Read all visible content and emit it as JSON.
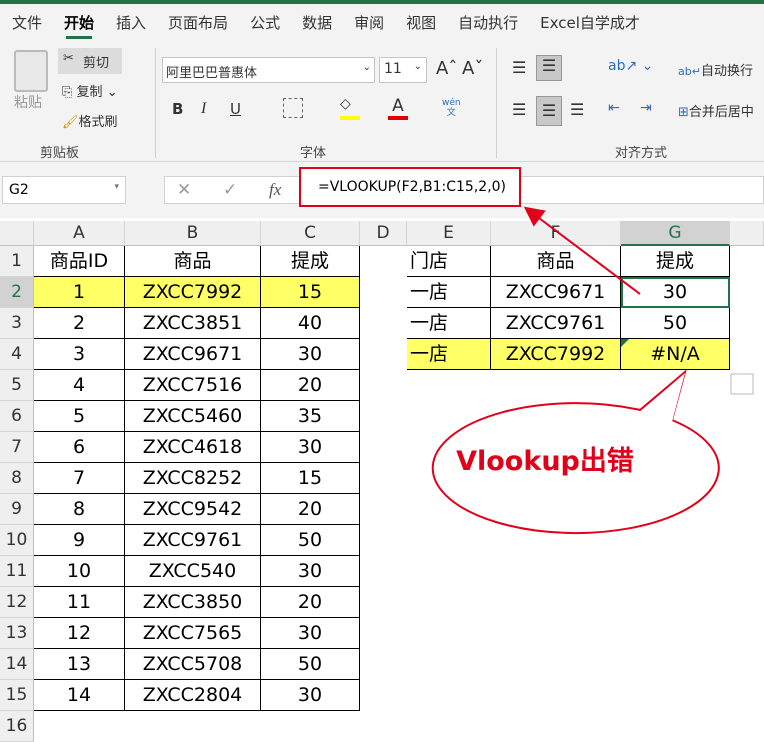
{
  "tabs": [
    "文件",
    "开始",
    "插入",
    "页面布局",
    "公式",
    "数据",
    "审阅",
    "视图",
    "自动执行",
    "Excel自学成才"
  ],
  "active_tab": "开始",
  "clipboard": {
    "paste": "粘贴",
    "cut": "剪切",
    "copy": "复制",
    "format_painter": "格式刷",
    "label": "剪贴板"
  },
  "font": {
    "name": "阿里巴巴普惠体",
    "size": "11",
    "bold": "B",
    "italic": "I",
    "underline": "U",
    "font_color": "A",
    "phonetic": "wén\n文",
    "label": "字体"
  },
  "alignment": {
    "wrap": "自动换行",
    "merge": "合并后居中",
    "label": "对齐方式"
  },
  "name_box": "G2",
  "formula": "=VLOOKUP(F2,B1:C15,2,0)",
  "fx": "fx",
  "columns": [
    "A",
    "B",
    "C",
    "D",
    "E",
    "F",
    "G"
  ],
  "rows": [
    "1",
    "2",
    "3",
    "4",
    "5",
    "6",
    "7",
    "8",
    "9",
    "10",
    "11",
    "12",
    "13",
    "14",
    "15",
    "16"
  ],
  "table1": {
    "headers": [
      "商品ID",
      "商品",
      "提成"
    ],
    "rows": [
      [
        "1",
        "ZXCC7992",
        "15"
      ],
      [
        "2",
        "ZXCC3851",
        "40"
      ],
      [
        "3",
        "ZXCC9671",
        "30"
      ],
      [
        "4",
        "ZXCC7516",
        "20"
      ],
      [
        "5",
        "ZXCC5460",
        "35"
      ],
      [
        "6",
        "ZXCC4618",
        "30"
      ],
      [
        "7",
        "ZXCC8252",
        "15"
      ],
      [
        "8",
        "ZXCC9542",
        "20"
      ],
      [
        "9",
        "ZXCC9761",
        "50"
      ],
      [
        "10",
        "ZXCC540",
        "30"
      ],
      [
        "11",
        "ZXCC3850",
        "20"
      ],
      [
        "12",
        "ZXCC7565",
        "30"
      ],
      [
        "13",
        "ZXCC5708",
        "50"
      ],
      [
        "14",
        "ZXCC2804",
        "30"
      ]
    ]
  },
  "table2": {
    "headers": [
      "门店",
      "商品",
      "提成"
    ],
    "rows": [
      [
        "一店",
        "ZXCC9671",
        "30"
      ],
      [
        "一店",
        "ZXCC9761",
        "50"
      ],
      [
        "一店",
        "ZXCC7992",
        "#N/A"
      ]
    ]
  },
  "callout": "Vlookup出错",
  "colors": {
    "accent": "#217346",
    "highlight": "#ffff66",
    "annotation": "#e0001a"
  }
}
